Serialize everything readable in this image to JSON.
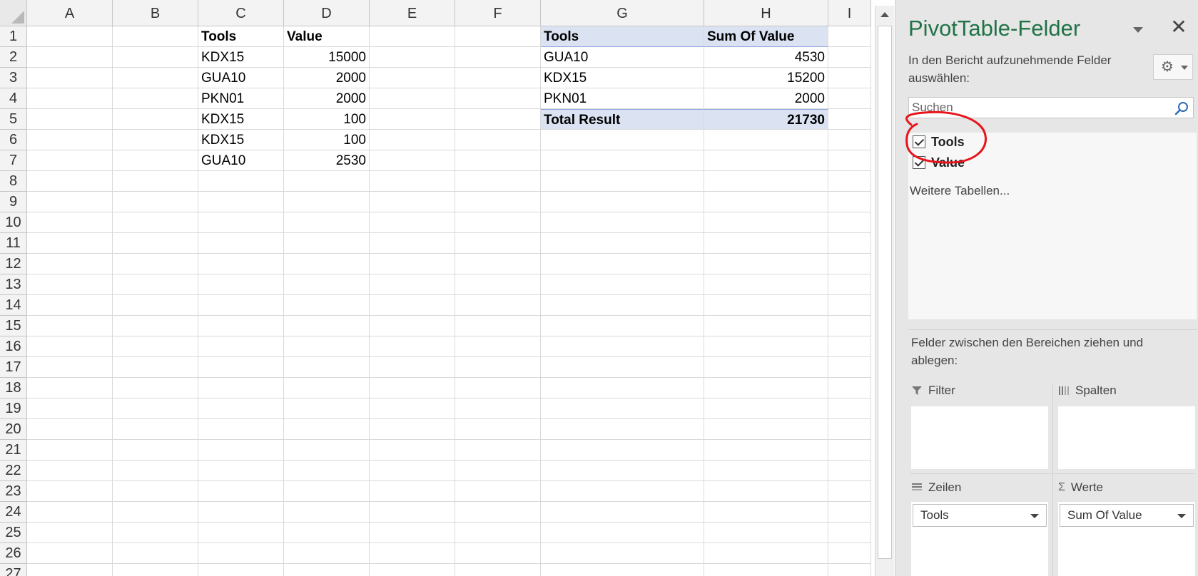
{
  "sheet": {
    "columns": [
      "A",
      "B",
      "C",
      "D",
      "E",
      "F",
      "G",
      "H",
      "I"
    ],
    "rows": [
      "1",
      "2",
      "3",
      "4",
      "5",
      "6",
      "7",
      "8",
      "9",
      "10",
      "11",
      "12",
      "13",
      "14",
      "15",
      "16",
      "17",
      "18",
      "19",
      "20",
      "21",
      "22",
      "23",
      "24",
      "25",
      "26",
      "27"
    ],
    "source_table": {
      "headers": [
        "Tools",
        "Value"
      ],
      "rows": [
        [
          "KDX15",
          "15000"
        ],
        [
          "GUA10",
          "2000"
        ],
        [
          "PKN01",
          "2000"
        ],
        [
          "KDX15",
          "100"
        ],
        [
          "KDX15",
          "100"
        ],
        [
          "GUA10",
          "2530"
        ]
      ]
    },
    "pivot_table": {
      "headers": [
        "Tools",
        "Sum Of Value"
      ],
      "rows": [
        [
          "GUA10",
          "4530"
        ],
        [
          "KDX15",
          "15200"
        ],
        [
          "PKN01",
          "2000"
        ]
      ],
      "total": [
        "Total Result",
        "21730"
      ],
      "header_color": "#dbe3f3"
    }
  },
  "panel": {
    "title": "PivotTable-Felder",
    "subtitle": "In den Bericht aufzunehmende Felder auswählen:",
    "close_glyph": "✕",
    "gear_glyph": "⚙",
    "search_placeholder": "Suchen",
    "fields": [
      {
        "label": "Tools",
        "checked": true
      },
      {
        "label": "Value",
        "checked": true
      }
    ],
    "more_tables": "Weitere Tabellen...",
    "areas_hint": "Felder zwischen den Bereichen ziehen und ablegen:",
    "areas": {
      "filter": {
        "label": "Filter",
        "icon": "filter-icon"
      },
      "columns": {
        "label": "Spalten",
        "icon": "columns-icon"
      },
      "rows": {
        "label": "Zeilen",
        "icon": "rows-icon",
        "field": "Tools"
      },
      "values": {
        "label": "Werte",
        "icon": "sigma-icon",
        "glyph": "Σ",
        "field": "Sum Of Value"
      }
    },
    "title_color": "#217346",
    "annotation_color": "#e8141b"
  }
}
